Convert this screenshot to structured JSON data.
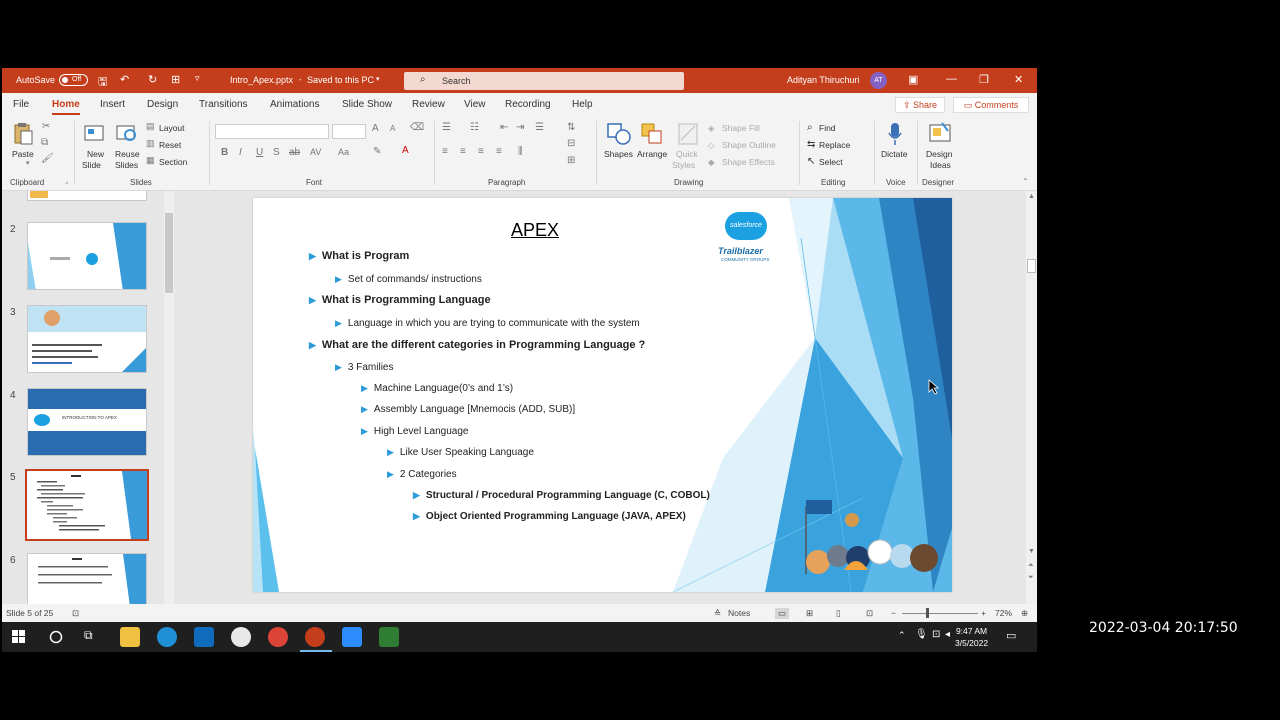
{
  "titlebar": {
    "autosave": "AutoSave",
    "autosave_state": "Off",
    "filename": "Intro_Apex.pptx",
    "save_status": "Saved to this PC",
    "search_placeholder": "Search",
    "user_name": "Adityan Thiruchuri",
    "user_initials": "AT",
    "accent_color": "#c43e1c"
  },
  "menu": {
    "tabs": [
      "File",
      "Home",
      "Insert",
      "Design",
      "Transitions",
      "Animations",
      "Slide Show",
      "Review",
      "View",
      "Recording",
      "Help"
    ],
    "active_tab": "Home",
    "share": "Share",
    "comments": "Comments"
  },
  "ribbon": {
    "clipboard": {
      "paste": "Paste",
      "group": "Clipboard"
    },
    "slides": {
      "new_slide_1": "New",
      "new_slide_2": "Slide",
      "reuse_1": "Reuse",
      "reuse_2": "Slides",
      "layout": "Layout",
      "reset": "Reset",
      "section": "Section",
      "group": "Slides"
    },
    "font": {
      "group": "Font",
      "bold": "B",
      "italic": "I",
      "underline": "U",
      "strike": "S",
      "spacing": "AV",
      "case": "Aa",
      "grow": "A",
      "shrink": "A"
    },
    "paragraph": {
      "group": "Paragraph"
    },
    "drawing": {
      "shapes": "Shapes",
      "arrange": "Arrange",
      "quick_1": "Quick",
      "quick_2": "Styles",
      "shape_fill": "Shape Fill",
      "shape_outline": "Shape Outline",
      "shape_effects": "Shape Effects",
      "group": "Drawing"
    },
    "editing": {
      "find": "Find",
      "replace": "Replace",
      "select": "Select",
      "group": "Editing"
    },
    "voice": {
      "dictate": "Dictate",
      "group": "Voice"
    },
    "designer": {
      "ideas_1": "Design",
      "ideas_2": "Ideas",
      "group": "Designer"
    }
  },
  "thumbnails": [
    {
      "num": "2"
    },
    {
      "num": "3"
    },
    {
      "num": "4",
      "caption": "INTRODUCTION TO APEX"
    },
    {
      "num": "5"
    },
    {
      "num": "6"
    }
  ],
  "slide": {
    "title": "APEX",
    "logo_text": "salesforce",
    "trail_text": "Trailblazer",
    "trail_sub": "COMMUNITY GROUPS",
    "bullets": [
      {
        "level": 1,
        "text": "What is Program"
      },
      {
        "level": 2,
        "text": "Set of commands/ instructions"
      },
      {
        "level": 1,
        "text": "What is Programming Language"
      },
      {
        "level": 2,
        "text": "Language in which you are trying to communicate with the system"
      },
      {
        "level": 1,
        "text": "What are the different categories in Programming Language ?"
      },
      {
        "level": 2,
        "text": "3 Families"
      },
      {
        "level": 3,
        "text": "Machine Language(0’s and 1’s)"
      },
      {
        "level": 3,
        "text": "Assembly Language [Mnemocis (ADD, SUB)]"
      },
      {
        "level": 3,
        "text": "High Level Language"
      },
      {
        "level": 4,
        "text": "Like User Speaking Language"
      },
      {
        "level": 4,
        "text": "2 Categories"
      },
      {
        "level": 5,
        "text": "Structural / Procedural Programming Language (C, COBOL)"
      },
      {
        "level": 5,
        "text": "Object Oriented Programming Language (JAVA, APEX)"
      }
    ]
  },
  "statusbar": {
    "slide_info": "Slide 5 of 25",
    "notes": "Notes",
    "zoom": "72%"
  },
  "taskbar": {
    "time": "9:47 AM",
    "date": "3/5/2022"
  },
  "overlay_timestamp": "2022-03-04  20:17:50"
}
